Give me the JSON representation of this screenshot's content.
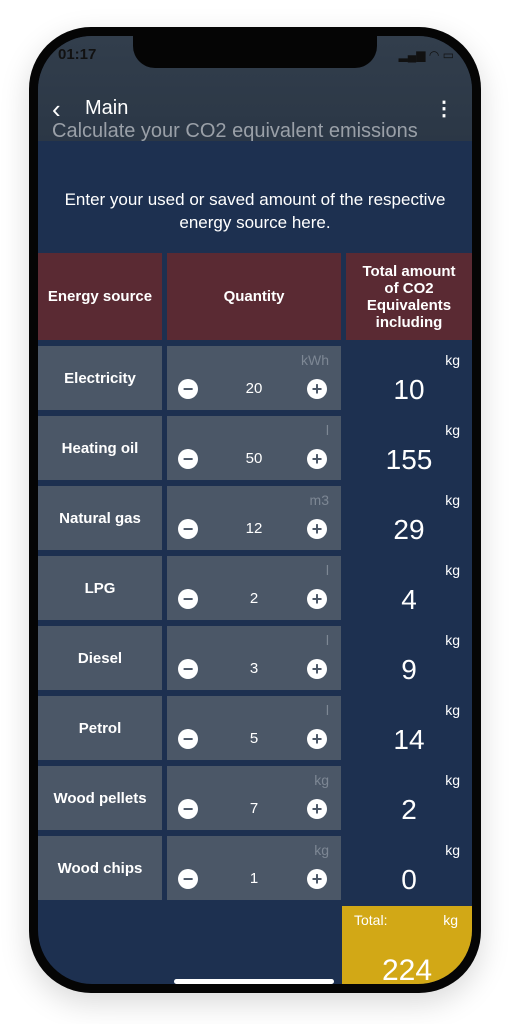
{
  "status_bar": {
    "time": "01:17",
    "icons": "signal wifi battery"
  },
  "nav": {
    "back_icon": "chevron-left",
    "title": "Main",
    "menu_icon": "more-vertical"
  },
  "subtitle": "Calculate your CO2 equivalent emissions",
  "intro": "Enter your used or saved amount of the respective energy source here.",
  "headers": {
    "source": "Energy source",
    "quantity": "Quantity",
    "total": "Total amount of CO2 Equivalents including"
  },
  "rows": [
    {
      "source": "Electricity",
      "unit": "kWh",
      "quantity": "20",
      "result_unit": "kg",
      "result": "10"
    },
    {
      "source": "Heating oil",
      "unit": "l",
      "quantity": "50",
      "result_unit": "kg",
      "result": "155"
    },
    {
      "source": "Natural gas",
      "unit": "m3",
      "quantity": "12",
      "result_unit": "kg",
      "result": "29"
    },
    {
      "source": "LPG",
      "unit": "l",
      "quantity": "2",
      "result_unit": "kg",
      "result": "4"
    },
    {
      "source": "Diesel",
      "unit": "l",
      "quantity": "3",
      "result_unit": "kg",
      "result": "9"
    },
    {
      "source": "Petrol",
      "unit": "l",
      "quantity": "5",
      "result_unit": "kg",
      "result": "14"
    },
    {
      "source": "Wood pellets",
      "unit": "kg",
      "quantity": "7",
      "result_unit": "kg",
      "result": "2"
    },
    {
      "source": "Wood chips",
      "unit": "kg",
      "quantity": "1",
      "result_unit": "kg",
      "result": "0"
    }
  ],
  "total": {
    "label": "Total:",
    "unit": "kg",
    "value": "224"
  },
  "colors": {
    "background": "#1d3050",
    "header_cell": "#5a2a33",
    "cell": "#4b5767",
    "total": "#d2a816"
  }
}
